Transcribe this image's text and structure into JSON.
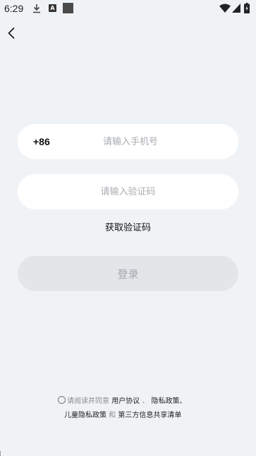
{
  "status_bar": {
    "time": "6:29",
    "a_badge": "A",
    "icons": [
      "download-icon",
      "a-badge-icon",
      "square-icon",
      "wifi-icon",
      "signal-icon",
      "battery-icon"
    ]
  },
  "login": {
    "country_code": "+86",
    "phone_placeholder": "请输入手机号",
    "code_placeholder": "请输入验证码",
    "get_code_label": "获取验证码",
    "login_label": "登录"
  },
  "agreement": {
    "prefix": "请阅读并同意",
    "user_agreement": "用户协议",
    "sep1": " 、 ",
    "privacy_policy": "隐私政策、",
    "child_privacy": "儿童隐私政策",
    "and": " 和 ",
    "third_party": "第三方信息共享清单"
  },
  "colors": {
    "background": "#f0f3f6",
    "input_bg": "#ffffff",
    "button_disabled_bg": "#e3e6e9",
    "button_disabled_text": "#a2a6ab",
    "placeholder": "#a9acb1"
  }
}
